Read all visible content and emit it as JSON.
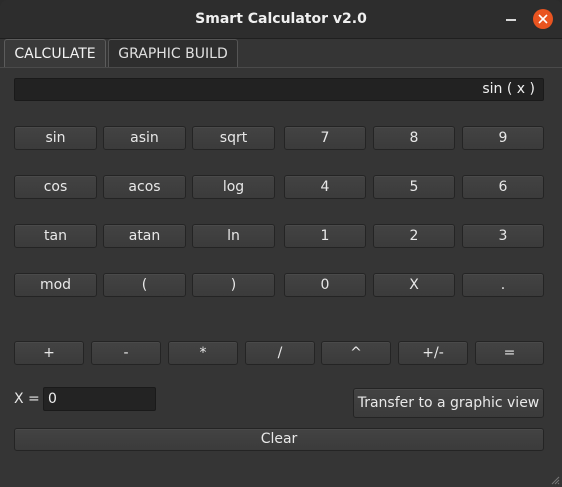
{
  "window": {
    "title": "Smart Calculator v2.0"
  },
  "tabs": [
    {
      "label": "CALCULATE",
      "active": true
    },
    {
      "label": "GRAPHIC BUILD",
      "active": false
    }
  ],
  "display": {
    "value": "sin ( x )"
  },
  "keypad": {
    "row1": [
      "sin",
      "asin",
      "sqrt",
      "7",
      "8",
      "9"
    ],
    "row2": [
      "cos",
      "acos",
      "log",
      "4",
      "5",
      "6"
    ],
    "row3": [
      "tan",
      "atan",
      "ln",
      "1",
      "2",
      "3"
    ],
    "row4": [
      "mod",
      "(",
      ")",
      "0",
      "X",
      "."
    ],
    "operators": [
      "+",
      "-",
      "*",
      "/",
      "^",
      "+/-",
      "="
    ]
  },
  "x_input": {
    "label": "X =",
    "value": "0"
  },
  "transfer_button": {
    "label": "Transfer to a graphic view"
  },
  "clear_button": {
    "label": "Clear"
  },
  "colors": {
    "close_button": "#e95420",
    "window_bg": "#353535",
    "button_bg": "#404040"
  }
}
